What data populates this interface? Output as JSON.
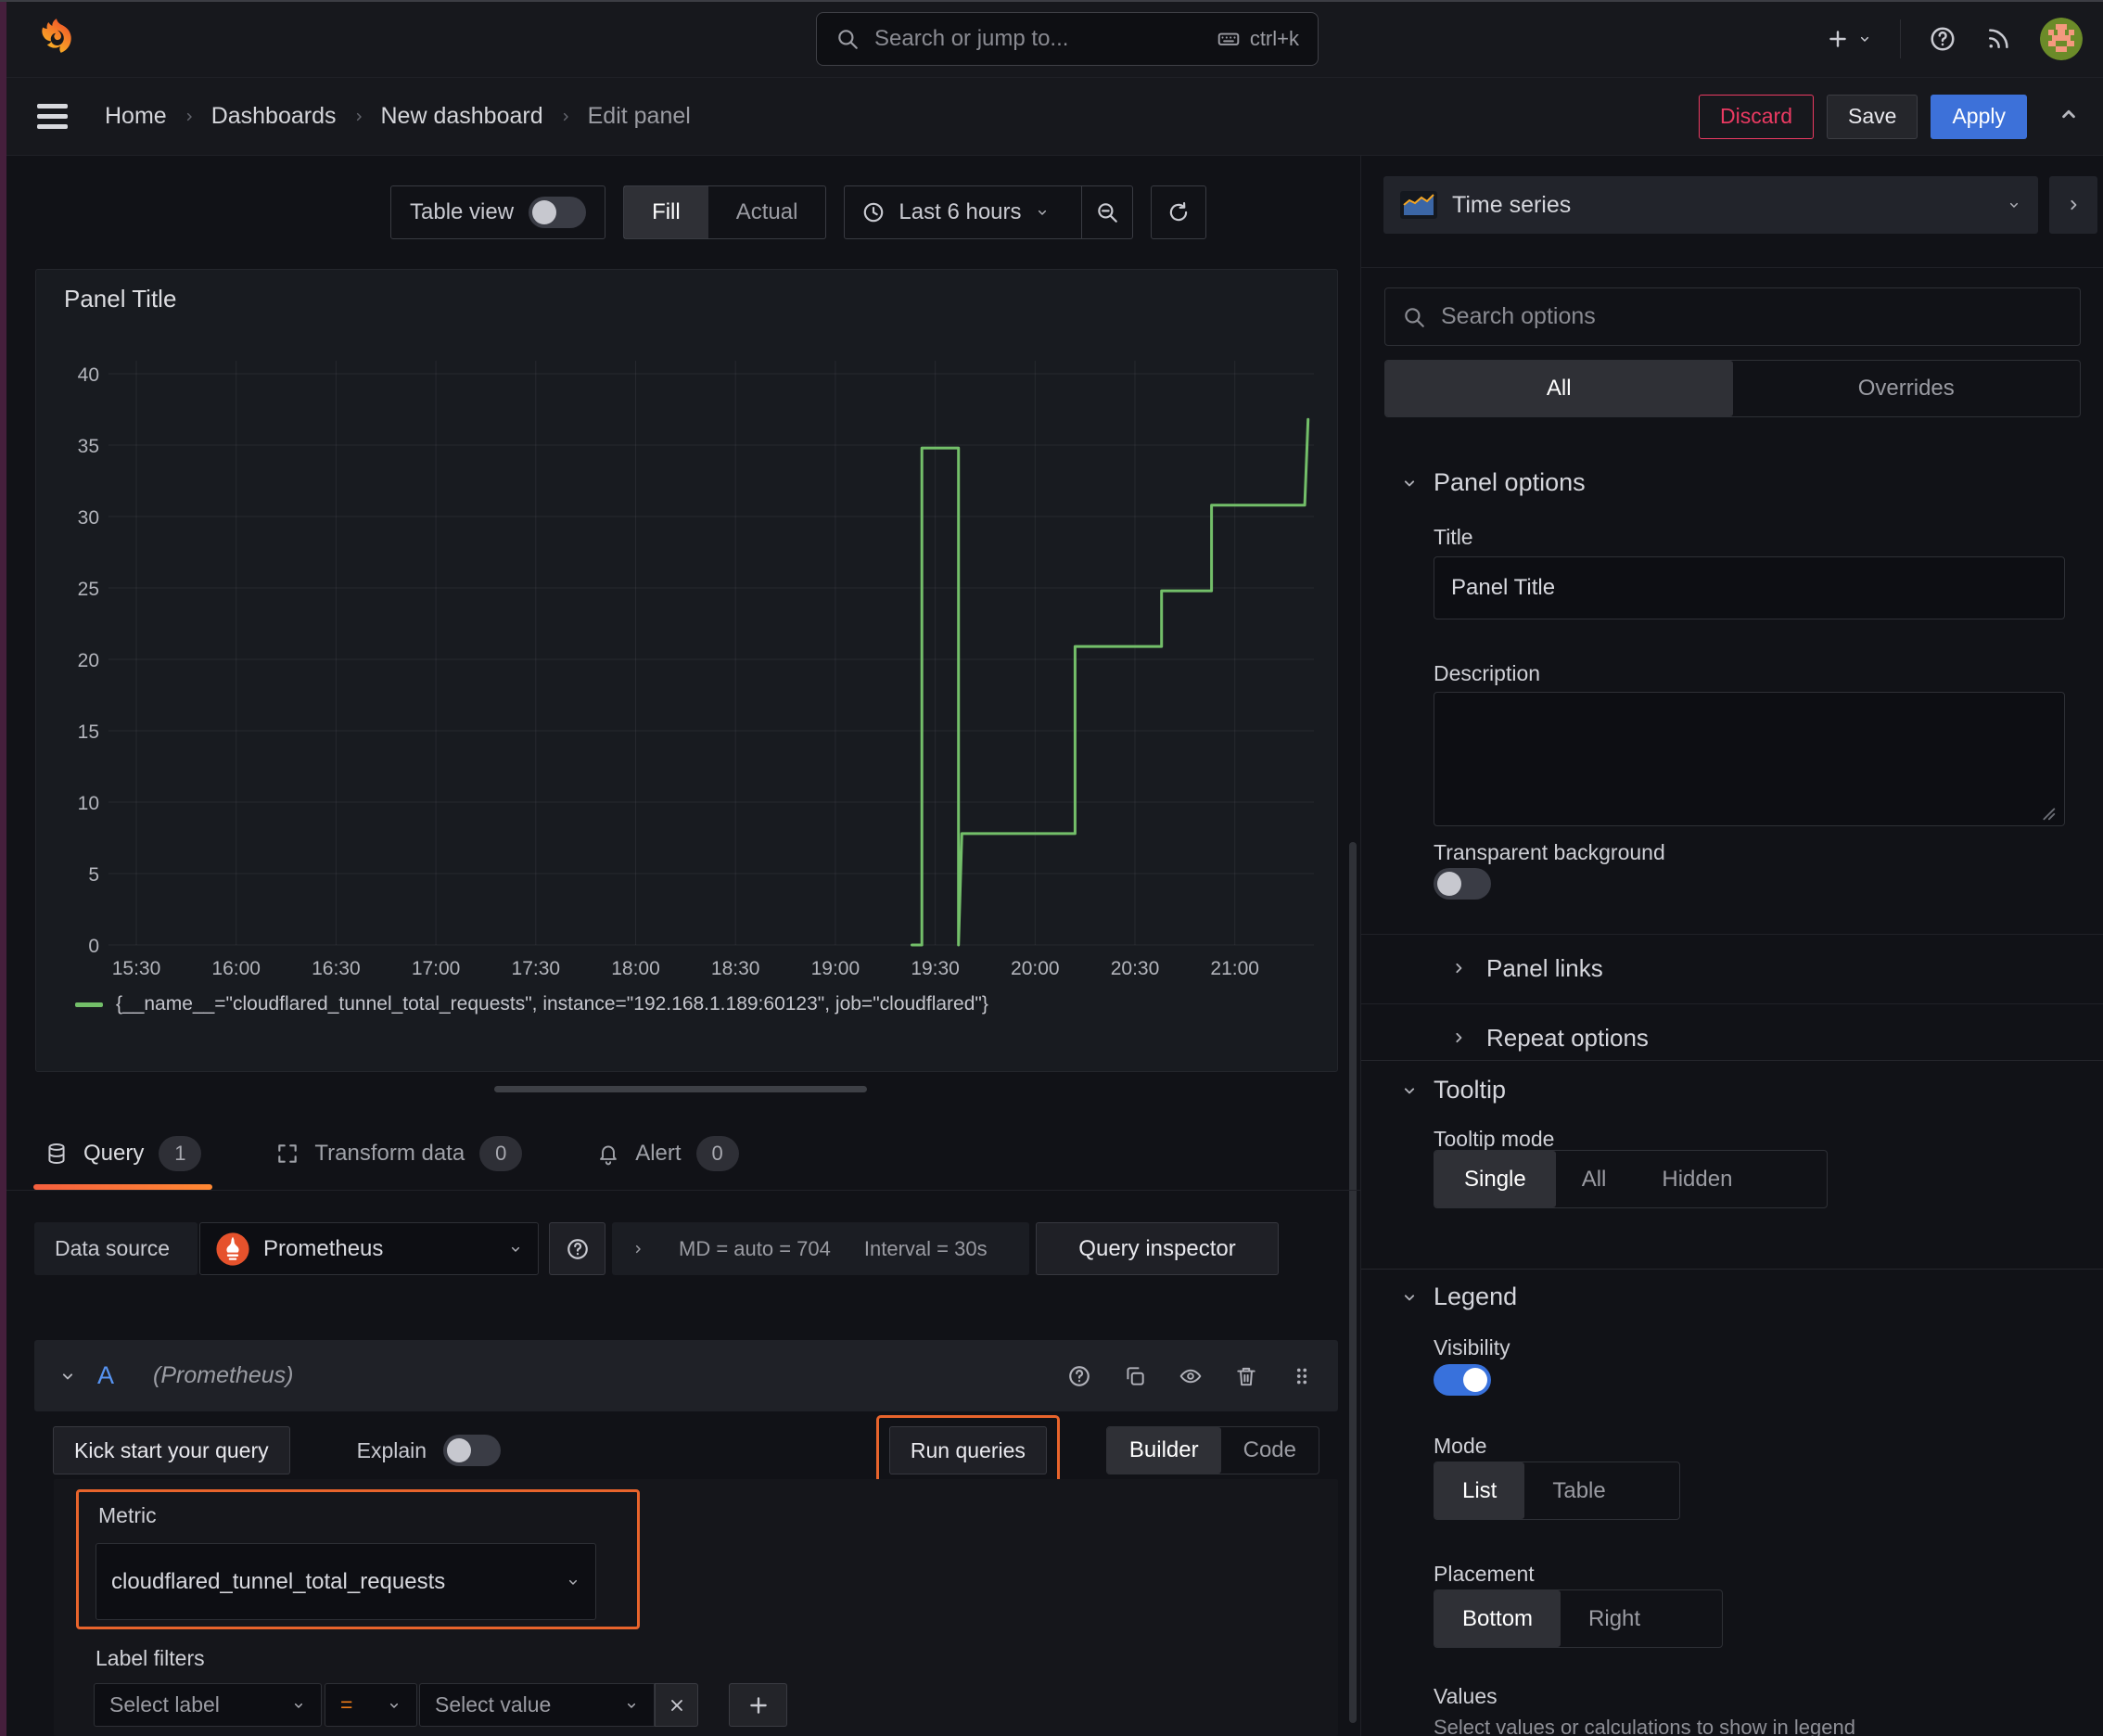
{
  "colors": {
    "accent_highlight": "#e8642c",
    "series_green": "#73bf69",
    "primary_blue": "#3d71d9",
    "discard_red": "#eb3a62",
    "toggle_on_blue": "#3871dc",
    "tab_underline_from": "#f55f3e",
    "tab_underline_to": "#ff8833"
  },
  "topnav": {
    "search_placeholder": "Search or jump to...",
    "search_shortcut": "ctrl+k"
  },
  "breadcrumb": {
    "items": [
      {
        "label": "Home"
      },
      {
        "label": "Dashboards"
      },
      {
        "label": "New dashboard"
      },
      {
        "label": "Edit panel"
      }
    ]
  },
  "actions": {
    "discard": "Discard",
    "save": "Save",
    "apply": "Apply"
  },
  "viz_toolbar": {
    "table_view": "Table view",
    "fill": "Fill",
    "actual": "Actual",
    "time_range": "Last 6 hours"
  },
  "panel": {
    "title": "Panel Title"
  },
  "chart_data": {
    "type": "line",
    "title": "Panel Title",
    "line_color": "#73bf69",
    "grid": true,
    "legend_position": "bottom",
    "xlabel": "",
    "ylabel": "",
    "ylim": [
      0,
      41
    ],
    "x_ticks": [
      "15:30",
      "16:00",
      "16:30",
      "17:00",
      "17:30",
      "18:00",
      "18:30",
      "19:00",
      "19:30",
      "20:00",
      "20:30",
      "21:00"
    ],
    "y_ticks": [
      0,
      5,
      10,
      15,
      20,
      25,
      30,
      35,
      40
    ],
    "series": [
      {
        "name": "{__name__=\"cloudflared_tunnel_total_requests\", instance=\"192.168.1.189:60123\", job=\"cloudflared\"}",
        "points": [
          [
            "19:23",
            0
          ],
          [
            "19:26",
            0
          ],
          [
            "19:26",
            34.8
          ],
          [
            "19:37",
            34.8
          ],
          [
            "19:37",
            0
          ],
          [
            "19:38",
            7.8
          ],
          [
            "20:12",
            7.8
          ],
          [
            "20:12",
            20.9
          ],
          [
            "20:38",
            20.9
          ],
          [
            "20:38",
            24.8
          ],
          [
            "20:53",
            24.8
          ],
          [
            "20:53",
            30.8
          ],
          [
            "21:21",
            30.8
          ],
          [
            "21:22",
            36.8
          ]
        ]
      }
    ]
  },
  "editor_tabs": {
    "query": {
      "label": "Query",
      "count": "1"
    },
    "transform": {
      "label": "Transform data",
      "count": "0"
    },
    "alert": {
      "label": "Alert",
      "count": "0"
    }
  },
  "datasource": {
    "label": "Data source",
    "name": "Prometheus",
    "stats_md": "MD = auto = 704",
    "stats_interval": "Interval = 30s",
    "inspector": "Query inspector"
  },
  "query": {
    "ref_id": "A",
    "ds_hint": "(Prometheus)",
    "kick_start": "Kick start your query",
    "explain": "Explain",
    "run_queries": "Run queries",
    "builder": "Builder",
    "code": "Code",
    "metric_label": "Metric",
    "metric_value": "cloudflared_tunnel_total_requests",
    "label_filters_label": "Label filters",
    "select_label": "Select label",
    "operator": "=",
    "select_value": "Select value"
  },
  "options": {
    "viz_name": "Time series",
    "search_placeholder": "Search options",
    "tab_all": "All",
    "tab_overrides": "Overrides",
    "panel_options": {
      "title": "Panel options",
      "title_label": "Title",
      "title_value": "Panel Title",
      "description_label": "Description",
      "transparent_label": "Transparent background"
    },
    "panel_links": "Panel links",
    "repeat_options": "Repeat options",
    "tooltip": {
      "title": "Tooltip",
      "mode_label": "Tooltip mode",
      "modes": [
        "Single",
        "All",
        "Hidden"
      ],
      "selected": "Single"
    },
    "legend": {
      "title": "Legend",
      "visibility_label": "Visibility",
      "mode_label": "Mode",
      "modes": [
        "List",
        "Table"
      ],
      "selected_mode": "List",
      "placement_label": "Placement",
      "placements": [
        "Bottom",
        "Right"
      ],
      "selected_placement": "Bottom",
      "values_label": "Values",
      "values_hint": "Select values or calculations to show in legend"
    }
  }
}
